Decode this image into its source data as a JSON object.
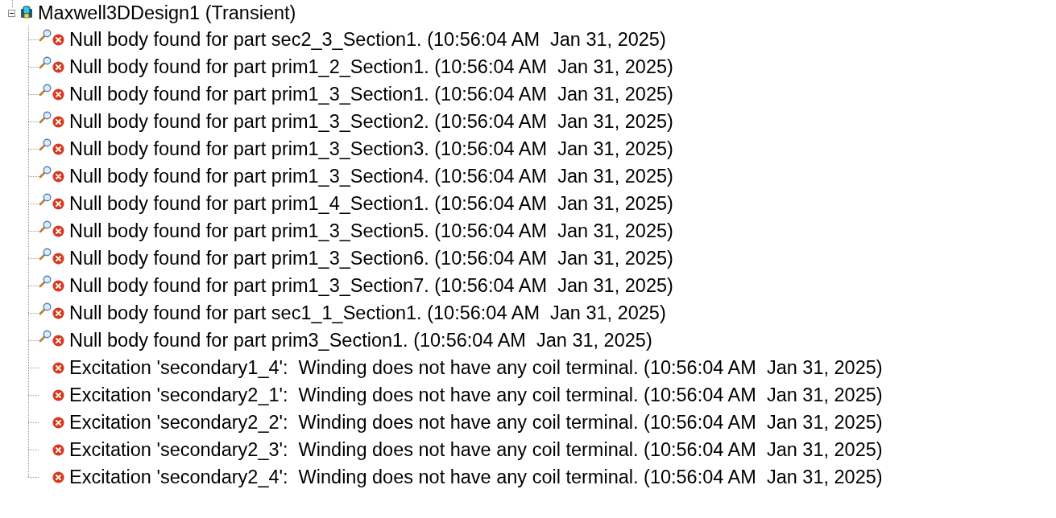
{
  "tree": {
    "label": "Maxwell3DDesign1 (Transient)",
    "expanded": true,
    "children": [
      {
        "kind": "part",
        "label": "Null body found for part sec2_3_Section1. (10:56:04 AM  Jan 31, 2025)"
      },
      {
        "kind": "part",
        "label": "Null body found for part prim1_2_Section1. (10:56:04 AM  Jan 31, 2025)"
      },
      {
        "kind": "part",
        "label": "Null body found for part prim1_3_Section1. (10:56:04 AM  Jan 31, 2025)"
      },
      {
        "kind": "part",
        "label": "Null body found for part prim1_3_Section2. (10:56:04 AM  Jan 31, 2025)"
      },
      {
        "kind": "part",
        "label": "Null body found for part prim1_3_Section3. (10:56:04 AM  Jan 31, 2025)"
      },
      {
        "kind": "part",
        "label": "Null body found for part prim1_3_Section4. (10:56:04 AM  Jan 31, 2025)"
      },
      {
        "kind": "part",
        "label": "Null body found for part prim1_4_Section1. (10:56:04 AM  Jan 31, 2025)"
      },
      {
        "kind": "part",
        "label": "Null body found for part prim1_3_Section5. (10:56:04 AM  Jan 31, 2025)"
      },
      {
        "kind": "part",
        "label": "Null body found for part prim1_3_Section6. (10:56:04 AM  Jan 31, 2025)"
      },
      {
        "kind": "part",
        "label": "Null body found for part prim1_3_Section7. (10:56:04 AM  Jan 31, 2025)"
      },
      {
        "kind": "part",
        "label": "Null body found for part sec1_1_Section1. (10:56:04 AM  Jan 31, 2025)"
      },
      {
        "kind": "part",
        "label": "Null body found for part prim3_Section1. (10:56:04 AM  Jan 31, 2025)"
      },
      {
        "kind": "excitation",
        "label": "Excitation 'secondary1_4':  Winding does not have any coil terminal. (10:56:04 AM  Jan 31, 2025)"
      },
      {
        "kind": "excitation",
        "label": "Excitation 'secondary2_1':  Winding does not have any coil terminal. (10:56:04 AM  Jan 31, 2025)"
      },
      {
        "kind": "excitation",
        "label": "Excitation 'secondary2_2':  Winding does not have any coil terminal. (10:56:04 AM  Jan 31, 2025)"
      },
      {
        "kind": "excitation",
        "label": "Excitation 'secondary2_3':  Winding does not have any coil terminal. (10:56:04 AM  Jan 31, 2025)"
      },
      {
        "kind": "excitation",
        "label": "Excitation 'secondary2_4':  Winding does not have any coil terminal. (10:56:04 AM  Jan 31, 2025)"
      }
    ]
  }
}
